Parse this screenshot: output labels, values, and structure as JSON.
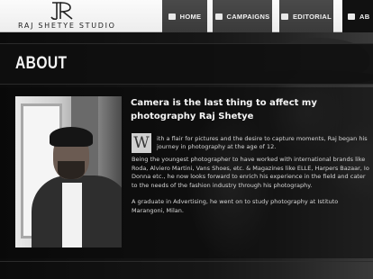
{
  "header": {
    "logo_text": "RAJ SHETYE STUDIO",
    "nav": [
      {
        "label": "HOME",
        "icon": "home-icon"
      },
      {
        "label": "CAMPAIGNS",
        "icon": "image-icon"
      },
      {
        "label": "EDITORIAL",
        "icon": "image-icon"
      },
      {
        "label": "AB",
        "icon": "image-icon"
      }
    ]
  },
  "page": {
    "title": "ABOUT"
  },
  "about": {
    "headline": "Camera is the last thing to affect my photography Raj Shetye",
    "dropcap": "W",
    "intro": "ith a flair for pictures and the desire to capture moments, Raj began his journey in photography at the age of 12.",
    "paragraph_2": "Being the youngest photographer to have worked with international brands like Roda, Alviero Martini, Vans Shoes, etc. & Magazines like ELLE, Harpers Bazaar, Io Donna etc., he now looks forward to enrich his experience in the field and cater to the needs of the fashion industry through his photography.",
    "paragraph_3": "A graduate in Advertising, he went on to study photography at Istituto Marangoni, Milan."
  },
  "colors": {
    "header_bg": "#f4f4f4",
    "nav_bg": "#424242",
    "page_bg": "#101010",
    "text": "#d7d7d7"
  }
}
